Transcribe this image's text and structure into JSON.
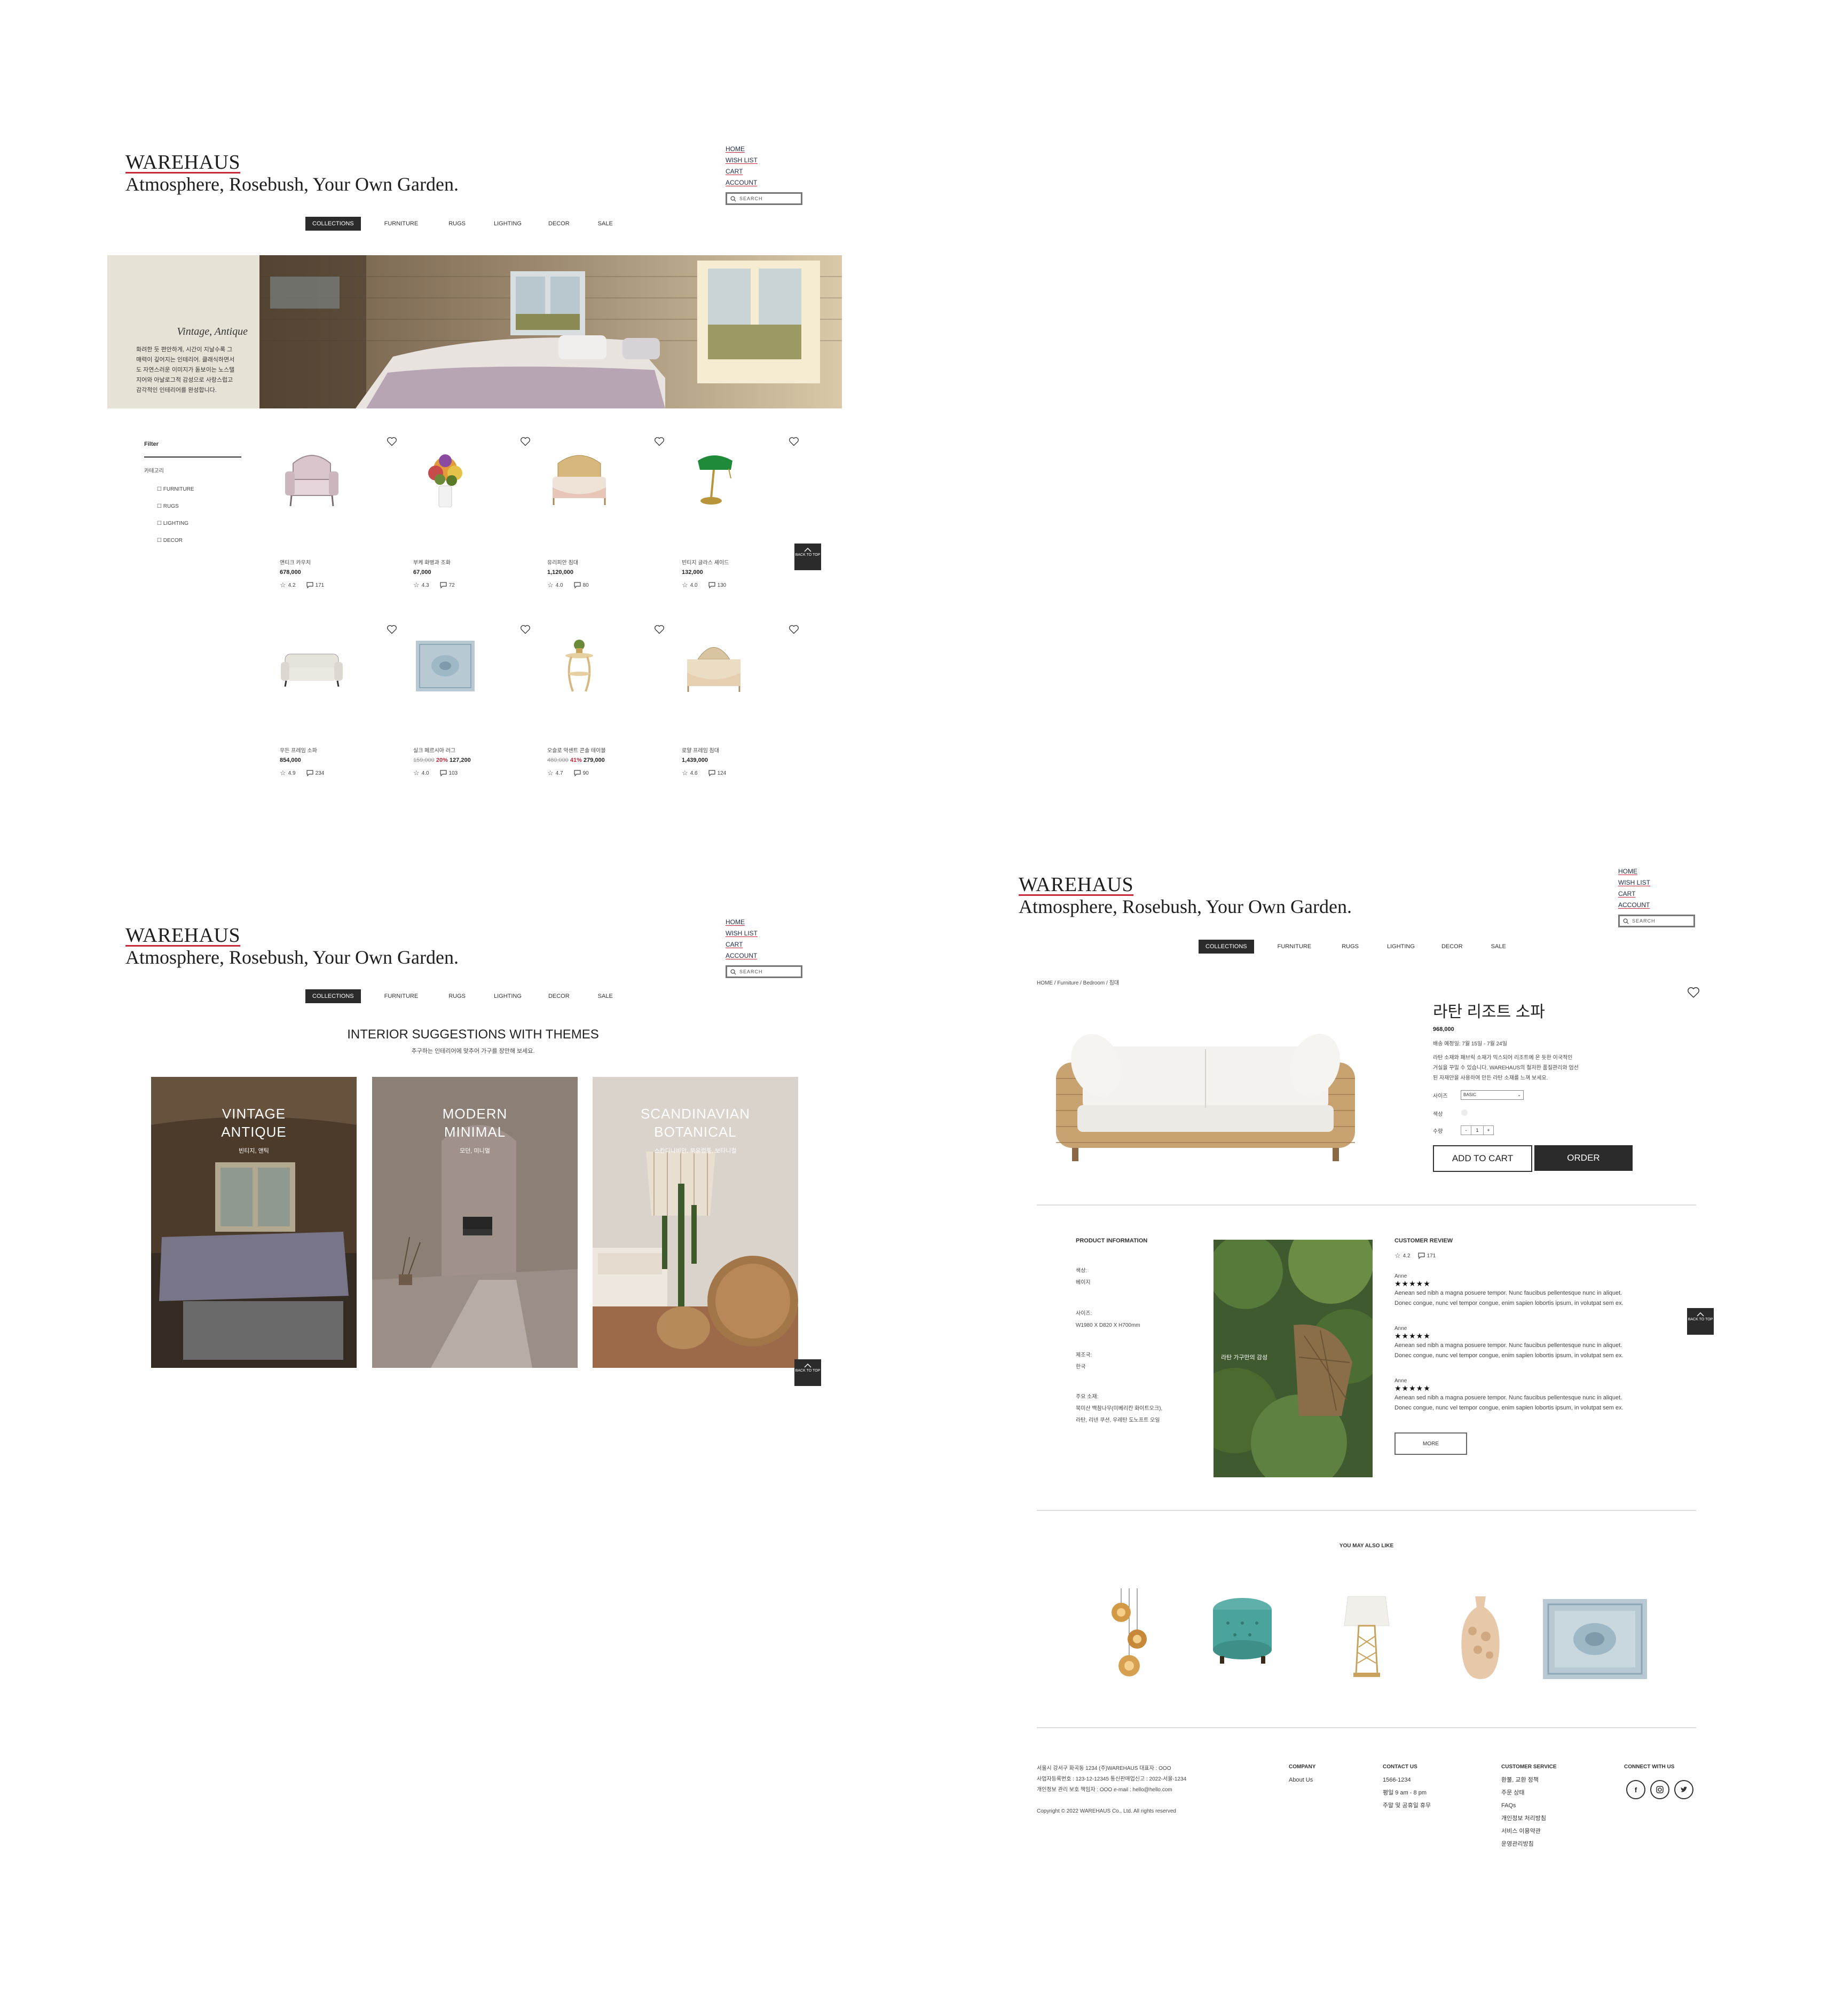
{
  "brand": "WAREHAUS",
  "tagline": "Atmosphere, Rosebush, Your Own Garden.",
  "top_nav": [
    "HOME",
    "WISH LIST",
    "CART",
    "ACCOUNT"
  ],
  "search_placeholder": "SEARCH",
  "main_menu": [
    "COLLECTIONS",
    "FURNITURE",
    "RUGS",
    "LIGHTING",
    "DECOR",
    "SALE"
  ],
  "colors": {
    "accent_red": "#c9273a",
    "dark": "#2b2b2b",
    "hero_bg": "#e7e2d6"
  },
  "back_to_top": "BACK TO TOP",
  "collection_page": {
    "hero": {
      "title": "Vintage, Antique",
      "text_lines": [
        "화려한 듯 편안하게, 시간이 지날수록 그",
        "매력이 깊어지는 인테리어. 클래식하면서",
        "도 자연스러운 이미지가 돋보이는 노스텔",
        "지어와 아날로그적 감성으로 사랑스럽고",
        "감각적인 인테리어를 완성합니다."
      ]
    },
    "filter": {
      "title": "Filter",
      "category_label": "카테고리",
      "options": [
        "FURNITURE",
        "RUGS",
        "LIGHTING",
        "DECOR"
      ]
    },
    "products": [
      {
        "name": "앤티크 카우치",
        "price": "678,000",
        "rating": "4.2",
        "reviews": "171",
        "icon": "armchair-icon"
      },
      {
        "name": "부케 화병과 조화",
        "price": "67,000",
        "rating": "4.3",
        "reviews": "72",
        "icon": "flower-vase-icon"
      },
      {
        "name": "유리피안 침대",
        "price": "1,120,000",
        "rating": "4.0",
        "reviews": "80",
        "icon": "bed-icon"
      },
      {
        "name": "빈티지 글라스 셰이드",
        "price": "132,000",
        "rating": "4.0",
        "reviews": "130",
        "icon": "banker-lamp-icon"
      },
      {
        "name": "우든 프레임 소파",
        "price": "854,000",
        "rating": "4.9",
        "reviews": "234",
        "icon": "sofa-icon"
      },
      {
        "name": "실크 페르시아 러그",
        "old_price": "159,000",
        "discount": "20%",
        "price": "127,200",
        "rating": "4.0",
        "reviews": "103",
        "icon": "rug-icon"
      },
      {
        "name": "오슬로 악센트 콘솔 테이블",
        "old_price": "480,000",
        "discount": "41%",
        "price": "279,000",
        "rating": "4.7",
        "reviews": "90",
        "icon": "side-table-icon"
      },
      {
        "name": "로얄 프레임 침대",
        "price": "1,439,000",
        "rating": "4.6",
        "reviews": "124",
        "icon": "royal-bed-icon"
      }
    ]
  },
  "themes_page": {
    "title": "INTERIOR SUGGESTIONS WITH THEMES",
    "subtitle": "추구하는 인테리어에 맞추어 가구를 장만해 보세요.",
    "cards": [
      {
        "title1": "VINTAGE",
        "title2": "ANTIQUE",
        "sub": "빈티지, 앤틱"
      },
      {
        "title1": "MODERN",
        "title2": "MINIMAL",
        "sub": "모던, 미니멀"
      },
      {
        "title1": "SCANDINAVIAN",
        "title2": "BOTANICAL",
        "sub": "스칸디나비안, 북유럽풍, 보타니컬"
      }
    ]
  },
  "detail_page": {
    "breadcrumb": "HOME / Furniture / Bedroom / 침대",
    "product_name": "라탄 리조트 소파",
    "price": "968,000",
    "shipping": "배송 예정일: 7월 15일 - 7월 24일",
    "description_lines": [
      "라탄 소재와 패브릭 소재가 믹스되어 리조트에 온 듯한 이국적인",
      "거실을 꾸밀 수 있습니다. WAREHAUS의 철저한 품질관리와 엄선",
      "된 자재만을 사용하여 만든 라탄 소재를 느껴 보세요."
    ],
    "size_label": "사이즈",
    "size_value": "BASIC",
    "color_label": "색상",
    "qty_label": "수량",
    "qty_minus": "-",
    "qty_value": "1",
    "qty_plus": "+",
    "add_to_cart": "ADD TO CART",
    "order": "ORDER",
    "info": {
      "title": "PRODUCT INFORMATION",
      "items": [
        {
          "label": "색상:",
          "value": "베이지"
        },
        {
          "label": "사이즈:",
          "value": "W1980 X D820 X H700mm"
        },
        {
          "label": "제조국:",
          "value": "한국"
        },
        {
          "label": "주요 소재:",
          "value": "북미산 백참나무(미베리칸 화이트오크),",
          "value2": "라탄, 리넨 쿠션, 우레탄 도노프트 오일"
        }
      ],
      "image_caption": "라탄 가구만의 감성"
    },
    "review": {
      "title": "CUSTOMER REVIEW",
      "rating": "4.2",
      "count": "171",
      "stars": "★★★★★",
      "entries": [
        {
          "author": "Anne",
          "line1": "Aenean sed nibh a magna posuere tempor. Nunc faucibus pellentesque nunc in aliquet.",
          "line2": "Donec congue, nunc vel tempor congue, enim sapien lobortis ipsum, in volutpat sem ex."
        },
        {
          "author": "Anne",
          "line1": "Aenean sed nibh a magna posuere tempor. Nunc faucibus pellentesque nunc in aliquet.",
          "line2": "Donec congue, nunc vel tempor congue, enim sapien lobortis ipsum, in volutpat sem ex."
        },
        {
          "author": "Anne",
          "line1": "Aenean sed nibh a magna posuere tempor. Nunc faucibus pellentesque nunc in aliquet.",
          "line2": "Donec congue, nunc vel tempor congue, enim sapien lobortis ipsum, in volutpat sem ex."
        }
      ],
      "more": "MORE"
    },
    "also_like": {
      "title": "YOU MAY ALSO LIKE",
      "items": [
        "pendant-lights-icon",
        "ottoman-icon",
        "table-lamp-icon",
        "vase-icon",
        "rug-icon"
      ]
    }
  },
  "footer": {
    "address_lines": [
      "서울시 강서구 화곡동 1234     (주)WAREHAUS 대표자 : OOO",
      "사업자등록번호 : 123-12-12345      통신판매업신고 : 2022-서울-1234",
      "개인정보 관리 보호 책임자 : OOO      e-mail : hello@hello.com"
    ],
    "copyright": "Copyright © 2022 WAREHAUS Co., Ltd. All rights reserved",
    "company": {
      "title": "COMPANY",
      "items": [
        "About Us"
      ]
    },
    "contact": {
      "title": "CONTACT US",
      "items": [
        "1566-1234",
        "평일 9 am - 8 pm",
        "주말 및 공휴일 휴무"
      ]
    },
    "service": {
      "title": "CUSTOMER SERVICE",
      "items": [
        "환불, 교환 정책",
        "주문 상태",
        "FAQs",
        "개인정보 처리방침",
        "서비스 이용약관",
        "운영관리방침"
      ]
    },
    "connect": {
      "title": "CONNECT WITH US",
      "icons": [
        "facebook-icon",
        "instagram-icon",
        "twitter-icon"
      ]
    }
  }
}
